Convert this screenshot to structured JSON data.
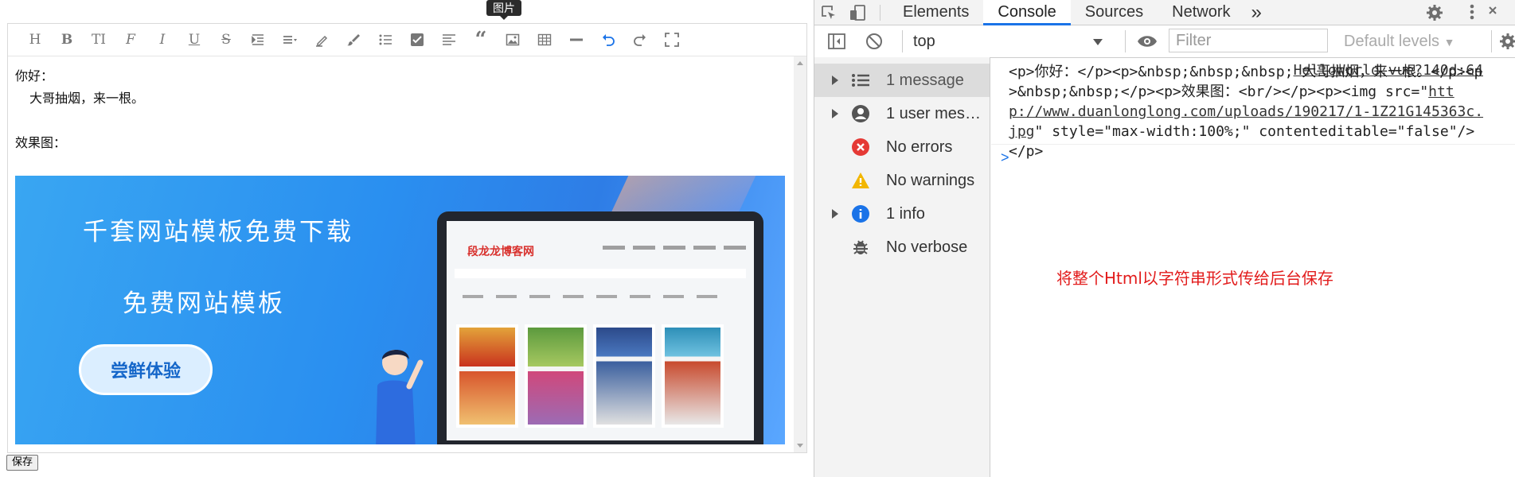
{
  "editor": {
    "tooltip": "图片",
    "toolbar": {
      "items": [
        "heading",
        "bold",
        "text-size",
        "italic-f",
        "italic",
        "underline",
        "strikethrough",
        "indent",
        "line-height",
        "highlighter",
        "brush",
        "bullet-list",
        "checkbox",
        "align-left",
        "quote",
        "image",
        "table",
        "horizontal-rule",
        "undo",
        "redo",
        "fullscreen"
      ]
    },
    "content": {
      "line1": "你好：",
      "line2": "大哥抽烟，来一根。",
      "line3": "效果图："
    },
    "banner": {
      "headline": "千套网站模板免费下载",
      "subheadline": "免费网站模板",
      "cta": "尝鲜体验",
      "site_logo": "段龙龙博客网"
    }
  },
  "save_button": "保存",
  "devtools": {
    "tabs": [
      "Elements",
      "Console",
      "Sources",
      "Network"
    ],
    "active_tab": "Console",
    "more_tabs": "»",
    "context": "top",
    "filter_placeholder": "Filter",
    "levels": "Default levels",
    "sidebar": [
      {
        "label": "1 message",
        "icon": "list-icon",
        "expandable": true,
        "selected": true
      },
      {
        "label": "1 user mess…",
        "icon": "user-icon",
        "expandable": true,
        "selected": false
      },
      {
        "label": "No errors",
        "icon": "error-icon",
        "expandable": false,
        "selected": false
      },
      {
        "label": "No warnings",
        "icon": "warning-icon",
        "expandable": false,
        "selected": false
      },
      {
        "label": "1 info",
        "icon": "info-icon",
        "expandable": true,
        "selected": false
      },
      {
        "label": "No verbose",
        "icon": "bug-icon",
        "expandable": false,
        "selected": false
      }
    ],
    "log": {
      "source": "HelloWorld.vue?140d:64",
      "text_before": "<p>你好：</p><p>&nbsp;&nbsp;&nbsp; 大哥抽烟，来一根。</p><p>&nbsp;&nbsp;</p><p>效果图：<br/></p><p><img src=\"",
      "link": "http://www.duanlonglong.com/uploads/190217/1-1Z21G145363c.jpg",
      "text_after": "\" style=\"max-width:100%;\" contenteditable=\"false\"/></p>"
    },
    "prompt": ">",
    "annotation": "将整个Html以字符串形式传给后台保存"
  },
  "colors": {
    "accent": "#1a73e8",
    "annotation": "#e21b1b",
    "error": "#d93025",
    "warning": "#f2b600",
    "info": "#1a73e8"
  }
}
